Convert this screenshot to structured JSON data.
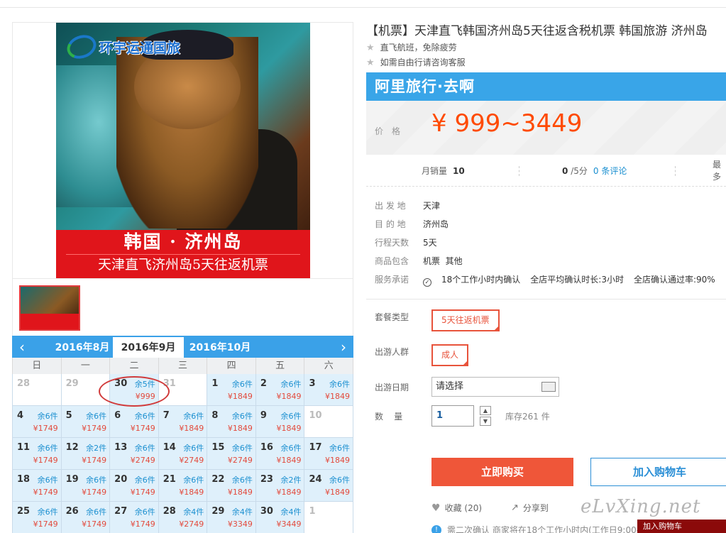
{
  "product": {
    "title": "【机票】天津直飞韩国济州岛5天往返含税机票 韩国旅游 济州岛",
    "tags": [
      "直飞航班，免除疲劳",
      "如需自由行请咨询客服"
    ],
    "logo_text": "环宇运通国旅",
    "poster_line1": "韩国 · 济州岛",
    "poster_line2": "天津直飞济州岛5天往返机票"
  },
  "price": {
    "brand": "阿里旅行·去啊",
    "label": "价格",
    "value": "¥ 999~3449"
  },
  "stats": {
    "sales_label": "月销量",
    "sales_value": "10",
    "rating_value": "0",
    "rating_suffix": "/5分",
    "reviews_link": "0 条评论",
    "more_label": "最多"
  },
  "info": [
    {
      "k": "出 发 地",
      "v": "天津"
    },
    {
      "k": "目 的 地",
      "v": "济州岛"
    },
    {
      "k": "行程天数",
      "v": "5天"
    },
    {
      "k": "商品包含",
      "v": "机票  其他"
    }
  ],
  "service": {
    "k": "服务承诺",
    "items": [
      "18个工作小时内确认",
      "全店平均确认时长:3小时",
      "全店确认通过率:90%"
    ]
  },
  "options": {
    "package_label": "套餐类型",
    "package_value": "5天往返机票",
    "crowd_label": "出游人群",
    "crowd_value": "成人",
    "date_label": "出游日期",
    "date_value": "请选择",
    "qty_label": "数    量",
    "qty_value": "1",
    "stock": "库存261 件"
  },
  "actions": {
    "buy": "立即购买",
    "cart": "加入购物车",
    "fav": "收藏",
    "fav_count": "(20)",
    "share": "分享到",
    "notice": "需二次确认  商家将在18个工作小时内(工作日9:00-"
  },
  "calendar": {
    "months": [
      "2016年8月",
      "2016年9月",
      "2016年10月"
    ],
    "weekdays": [
      "日",
      "一",
      "二",
      "三",
      "四",
      "五",
      "六"
    ],
    "weeks": [
      [
        {
          "d": "28",
          "e": true
        },
        {
          "d": "29",
          "e": true
        },
        {
          "d": "30",
          "s": "余5件",
          "p": "¥999"
        },
        {
          "d": "31",
          "e": true
        },
        {
          "d": "1",
          "s": "余6件",
          "p": "¥1849"
        },
        {
          "d": "2",
          "s": "余6件",
          "p": "¥1849"
        },
        {
          "d": "3",
          "s": "余6件",
          "p": "¥1849"
        }
      ],
      [
        {
          "d": "4",
          "s": "余6件",
          "p": "¥1749"
        },
        {
          "d": "5",
          "s": "余6件",
          "p": "¥1749"
        },
        {
          "d": "6",
          "s": "余6件",
          "p": "¥1749"
        },
        {
          "d": "7",
          "s": "余6件",
          "p": "¥1849"
        },
        {
          "d": "8",
          "s": "余6件",
          "p": "¥1849"
        },
        {
          "d": "9",
          "s": "余6件",
          "p": "¥1849"
        },
        {
          "d": "10",
          "e": true
        }
      ],
      [
        {
          "d": "11",
          "s": "余6件",
          "p": "¥1749"
        },
        {
          "d": "12",
          "s": "余2件",
          "p": "¥1749"
        },
        {
          "d": "13",
          "s": "余6件",
          "p": "¥2749"
        },
        {
          "d": "14",
          "s": "余6件",
          "p": "¥2749"
        },
        {
          "d": "15",
          "s": "余6件",
          "p": "¥2749"
        },
        {
          "d": "16",
          "s": "余6件",
          "p": "¥1849"
        },
        {
          "d": "17",
          "s": "余6件",
          "p": "¥1849"
        }
      ],
      [
        {
          "d": "18",
          "s": "余6件",
          "p": "¥1749"
        },
        {
          "d": "19",
          "s": "余6件",
          "p": "¥1749"
        },
        {
          "d": "20",
          "s": "余6件",
          "p": "¥1749"
        },
        {
          "d": "21",
          "s": "余6件",
          "p": "¥1849"
        },
        {
          "d": "22",
          "s": "余6件",
          "p": "¥1849"
        },
        {
          "d": "23",
          "s": "余2件",
          "p": "¥1849"
        },
        {
          "d": "24",
          "s": "余6件",
          "p": "¥1849"
        }
      ],
      [
        {
          "d": "25",
          "s": "余6件",
          "p": "¥1749"
        },
        {
          "d": "26",
          "s": "余6件",
          "p": "¥1749"
        },
        {
          "d": "27",
          "s": "余6件",
          "p": "¥1749"
        },
        {
          "d": "28",
          "s": "余4件",
          "p": "¥2749"
        },
        {
          "d": "29",
          "s": "余4件",
          "p": "¥3349"
        },
        {
          "d": "30",
          "s": "余4件",
          "p": "¥3449"
        },
        {
          "d": "1",
          "e": true
        }
      ]
    ]
  },
  "watermark": "eLvXing.net",
  "corner_bar": "加入购物车",
  "colors": {
    "accent": "#ff4a00",
    "brand_blue": "#39a5e8",
    "buy": "#ef5639"
  }
}
